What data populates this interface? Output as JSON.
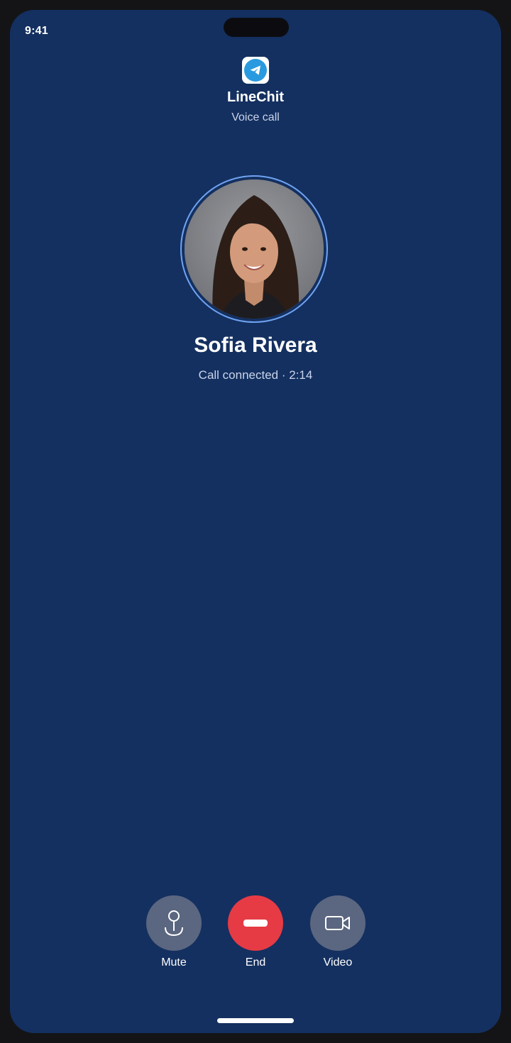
{
  "status_bar": {
    "time": "9:41"
  },
  "app": {
    "name": "LineChit",
    "call_type": "Voice call",
    "icon": "paper-plane-icon"
  },
  "caller": {
    "name": "Sofia Rivera",
    "status": "Call connected · 2:14"
  },
  "controls": [
    {
      "id": "mute",
      "label": "Mute",
      "icon": "microphone-icon",
      "color": "#5b6680"
    },
    {
      "id": "end",
      "label": "End",
      "icon": "end-call-icon",
      "color": "#e63b45"
    },
    {
      "id": "video",
      "label": "Video",
      "icon": "video-camera-icon",
      "color": "#5b6680"
    }
  ],
  "colors": {
    "background": "#143060",
    "accent_ring": "#6fa3f2",
    "end_call": "#e63b45",
    "app_icon": "#2A9AE0"
  }
}
